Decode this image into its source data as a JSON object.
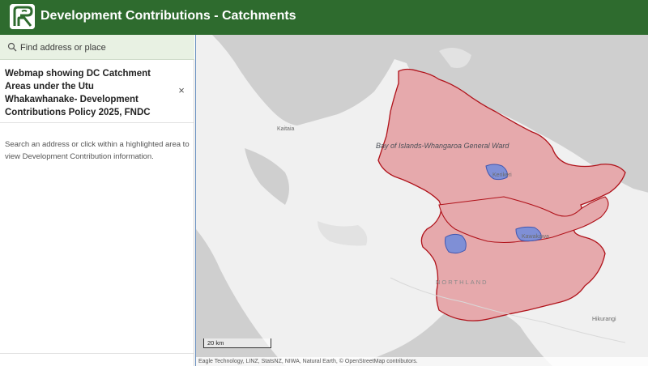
{
  "header": {
    "title": "Development Contributions - Catchments",
    "logo_icon": "fndc-logo-icon",
    "background": "#2e6b2e"
  },
  "search": {
    "placeholder": "Find address or place",
    "icon": "search-icon"
  },
  "panel": {
    "title": "Webmap showing DC Catchment Areas under the Utu Whakawhanake- Development Contributions Policy 2025, FNDC",
    "close_label": "×",
    "body": "Search an address or click within a highlighted area to view Development Contribution information."
  },
  "map": {
    "labels": {
      "kaitaia": "Kaitaia",
      "ward": "Bay of Islands-Whangaroa General Ward",
      "kerikeri": "Kerikeri",
      "kawakawa": "Kawakawa",
      "northland": "NORTHLAND",
      "hikurangi": "Hikurangi"
    },
    "scale_label": "20 km",
    "attribution": "Eagle Technology, LINZ, StatsNZ, NIWA, Natural Earth, © OpenStreetMap contributors.",
    "colors": {
      "sea": "#cfcfcf",
      "land": "#f0f0f0",
      "ward_fill": "#e6a9ac",
      "ward_stroke": "#b0121a",
      "catchment_fill": "#7f8fd6",
      "catchment_stroke": "#4057b0"
    }
  }
}
